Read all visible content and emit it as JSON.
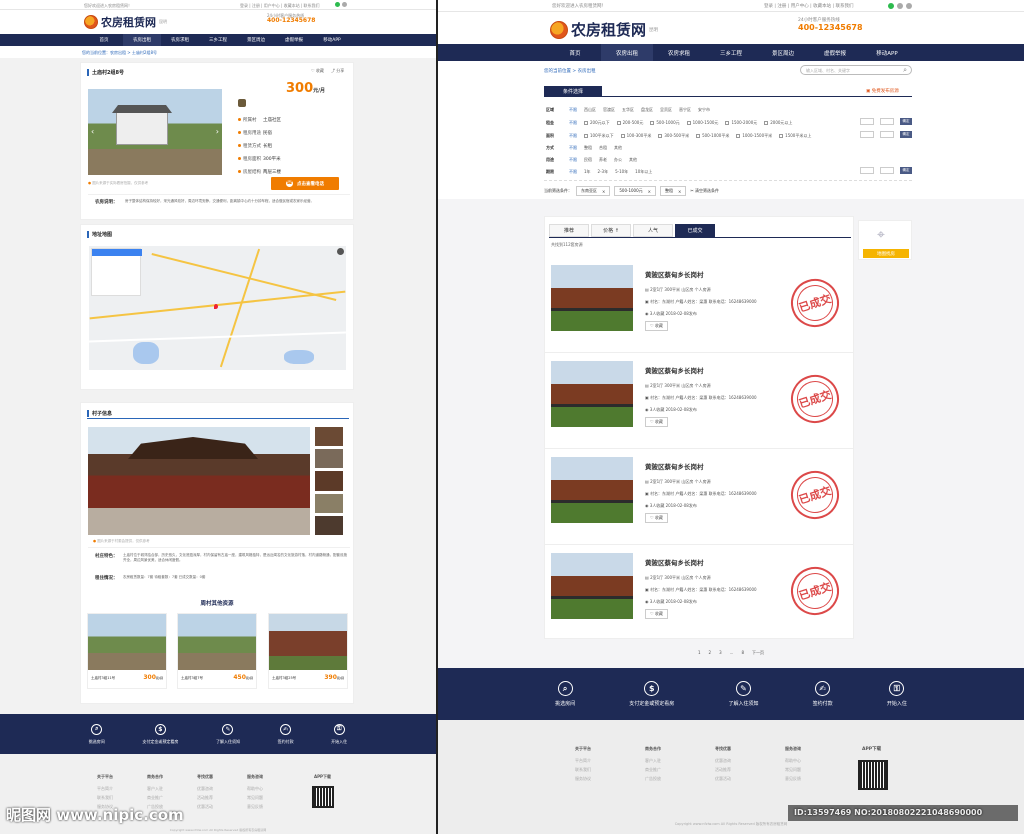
{
  "brand": {
    "name": "农房租赁网",
    "city": "昆明",
    "hotline_label": "24小时客户服务热线",
    "hotline": "400-12345678",
    "accent": "#f07c00",
    "navy": "#1e2a55"
  },
  "topbar": {
    "left": "您好欢迎进入农房租赁网！",
    "right": "登录  |  注册  |  用户中心  |  收藏本站  |  联系我们"
  },
  "nav": [
    "首页",
    "农房出租",
    "农房求租",
    "三乡工程",
    "景区周边",
    "虚假举报",
    "移动APP"
  ],
  "left": {
    "breadcrumb": "您的当前位置：农房出租 > 土庙村2组8号",
    "title": "土庙村2组8号",
    "actions": [
      "收藏",
      "分享"
    ],
    "price": "300",
    "price_unit": "元/月",
    "specs": [
      {
        "k": "所属村",
        "v": "土庙社区"
      },
      {
        "k": "租房用途",
        "v": "民宿"
      },
      {
        "k": "租赁方式",
        "v": "长租"
      },
      {
        "k": "租房面积",
        "v": "300平米"
      },
      {
        "k": "房屋结构",
        "v": "两层三楼"
      }
    ],
    "call_btn": "点击查看电话",
    "photo_caption": "图片来源于实际看房拍摄，仅供参考",
    "desc_label": "农房说明：",
    "desc": "房子整体结构保持较好，采光通风较好，周边环境安静，交通便利，距离镇中心约十分钟车程，适合做民宿或农家乐经营。",
    "map_title": "地址地图",
    "village_title": "村子信息",
    "village_caption": "图片来源于村委会提供，仅供参考",
    "village_feature_label": "村庄特色：",
    "village_feature": "土庙村位于城郊结合部，历史悠久，文化底蕴深厚，村内保留有古庙一座，建筑风格独特，是远近闻名的文化旅游村落，村内道路畅通，配套设施齐全，周边风景优美，适合休闲度假。",
    "village_env_label": "租住情况：",
    "village_env": "农房租赁数量：7套    待租套数：7套    已成交数量：0套",
    "others_title": "周村其他资源",
    "others": [
      {
        "name": "土庙村3组11号",
        "price": "300",
        "unit": "元/月"
      },
      {
        "name": "土庙村3组7号",
        "price": "450",
        "unit": "元/月"
      },
      {
        "name": "土庙村3组25号",
        "price": "390",
        "unit": "元/月"
      }
    ]
  },
  "steps": [
    {
      "icon": "search-icon",
      "glyph": "⌕",
      "label": "挑选房间"
    },
    {
      "icon": "yen-icon",
      "glyph": "$",
      "label": "支付定金或预定看房"
    },
    {
      "icon": "document-icon",
      "glyph": "✎",
      "label": "了解入住须知"
    },
    {
      "icon": "contract-icon",
      "glyph": "✍",
      "label": "签约付款"
    },
    {
      "icon": "key-icon",
      "glyph": "⚿",
      "label": "开始入住"
    }
  ],
  "footer": {
    "cols": [
      {
        "h": "关于平台",
        "items": [
          "平台简介",
          "联系我们",
          "服务协议"
        ]
      },
      {
        "h": "商务合作",
        "items": [
          "客户入驻",
          "商业推广",
          "广告投放"
        ]
      },
      {
        "h": "寻找优惠",
        "items": [
          "优惠咨询",
          "活动推荐",
          "优惠活动"
        ]
      },
      {
        "h": "服务咨询",
        "items": [
          "帮助中心",
          "常见问题",
          "意见反馈"
        ]
      }
    ],
    "app_label": "APP下载",
    "copyright": "Copyright www.nfzlw.com All Rights Reserved 版权所有农房租赁网"
  },
  "right": {
    "breadcrumb": "您的当前位置 > 农房出租",
    "search_placeholder": "输入区域、村名、关键字",
    "filter_title": "条件选择",
    "publish": "免费发布房源",
    "filters": [
      {
        "label": "区域",
        "opts": [
          "不限",
          "西山区",
          "官渡区",
          "五华区",
          "盘龙区",
          "呈贡区",
          "晋宁区",
          "安宁市"
        ]
      },
      {
        "label": "租金",
        "opts": [
          "不限",
          "200元以下",
          "200-500元",
          "500-1000元",
          "1000-1500元",
          "1500-2000元",
          "2000元以上"
        ]
      },
      {
        "label": "面积",
        "opts": [
          "不限",
          "100平米以下",
          "100-300平米",
          "300-500平米",
          "500-1000平米",
          "1000-1500平米",
          "1500平米以上"
        ]
      },
      {
        "label": "方式",
        "opts": [
          "不限",
          "整租",
          "合租",
          "其他"
        ]
      },
      {
        "label": "用途",
        "opts": [
          "不限",
          "民宿",
          "养老",
          "办公",
          "其他"
        ]
      },
      {
        "label": "期限",
        "opts": [
          "不限",
          "1年",
          "2-3年",
          "5-10年",
          "10年以上"
        ]
      }
    ],
    "ok": "确定",
    "selected_label": "当前筛选条件：",
    "chips": [
      "东南亚区",
      "500-1000元",
      "整租"
    ],
    "clear": "清空筛选条件",
    "tabs": [
      "推荐",
      "价格 ↑",
      "人气",
      "已成交"
    ],
    "count": "共找到112套房源",
    "map_btn": "地图找房",
    "listings": [
      {
        "title": "黄陂区蔡甸乡长岗村",
        "spec": "2室1厅    300平米    山区房    个人房源",
        "contact": "村名：东湖村  户籍人姓名：梁惠  联系电话：16248639000",
        "meta": "3人收藏    2018-02-08发布",
        "fav": "收藏",
        "stamp": "已成交"
      },
      {
        "title": "黄陂区蔡甸乡长岗村",
        "spec": "2室1厅    300平米    山区房    个人房源",
        "contact": "村名：东湖村  户籍人姓名：梁惠  联系电话：16248639000",
        "meta": "3人收藏    2018-02-08发布",
        "fav": "收藏",
        "stamp": "已成交"
      },
      {
        "title": "黄陂区蔡甸乡长岗村",
        "spec": "2室1厅    300平米    山区房    个人房源",
        "contact": "村名：东湖村  户籍人姓名：梁惠  联系电话：16248639000",
        "meta": "3人收藏    2018-02-08发布",
        "fav": "收藏",
        "stamp": "已成交"
      },
      {
        "title": "黄陂区蔡甸乡长岗村",
        "spec": "2室1厅    300平米    山区房    个人房源",
        "contact": "村名：东湖村  户籍人姓名：梁惠  联系电话：16248639000",
        "meta": "3人收藏    2018-02-08发布",
        "fav": "收藏",
        "stamp": "已成交"
      }
    ],
    "pagination": [
      "1",
      "2",
      "3",
      "...",
      "8",
      "下一页"
    ]
  },
  "watermark": {
    "left": "昵图网 www.nipic.com",
    "right": "ID:13597469 NO:20180802221048690000"
  }
}
